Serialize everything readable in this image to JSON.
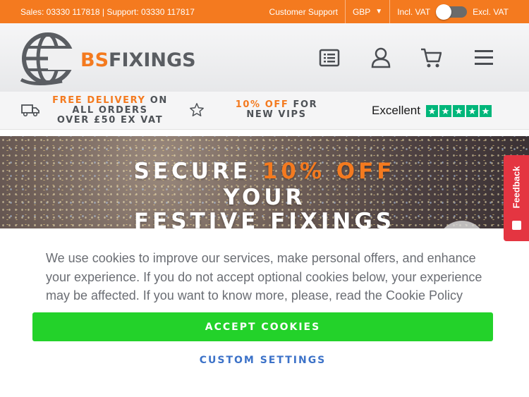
{
  "topbar": {
    "sales_support": "Sales: 03330 117818 | Support: 03330 117817",
    "customer_support": "Customer Support",
    "currency": "GBP",
    "incl_vat": "Incl. VAT",
    "excl_vat": "Excl. VAT"
  },
  "header": {
    "logo_bs": "BS",
    "logo_fixings": "FIXINGS",
    "icons": [
      "list-icon",
      "account-icon",
      "cart-icon",
      "menu-icon"
    ]
  },
  "usp": {
    "delivery_hl": "FREE DELIVERY",
    "delivery_rest": " ON ALL ORDERS",
    "delivery_line2": "OVER £50 EX VAT",
    "vip_hl": "10% OFF",
    "vip_rest": " FOR NEW VIPS",
    "trustpilot_word": "Excellent"
  },
  "hero": {
    "line1_a": "SECURE ",
    "line1_accent": "10% OFF",
    "line2": "YOUR",
    "line3": "FESTIVE FIXINGS"
  },
  "feedback": {
    "label": "Feedback"
  },
  "cookie": {
    "message": "We use cookies to improve our services, make personal offers, and enhance your experience. If you do not accept optional cookies below, your experience may be affected. If you want to know more, please, read the Cookie Policy",
    "accept_label": "ACCEPT COOKIES",
    "custom_label": "CUSTOM SETTINGS"
  },
  "colors": {
    "brand_orange": "#f47a1f",
    "accept_green": "#23d22a",
    "link_blue": "#3c72c8",
    "trustpilot_green": "#00b67a",
    "feedback_red": "#e43541"
  }
}
